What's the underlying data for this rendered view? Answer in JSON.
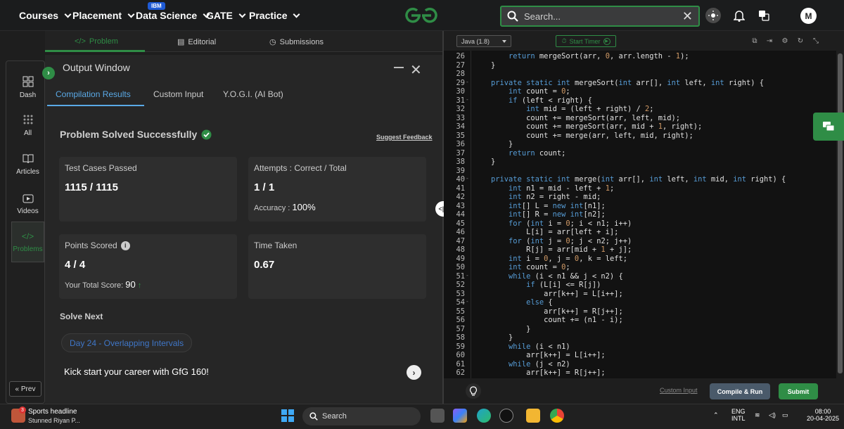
{
  "topnav": {
    "items": [
      "Courses",
      "Placement",
      "Data Science",
      "GATE",
      "Practice"
    ],
    "ibm_badge": "IBM",
    "search_placeholder": "Search...",
    "avatar_letter": "M"
  },
  "subtabs": [
    "Problem",
    "Editorial",
    "Submissions"
  ],
  "sidebar": {
    "items": [
      "Dash",
      "All",
      "Articles",
      "Videos",
      "Problems"
    ],
    "prev_label": "« Prev"
  },
  "output": {
    "title": "Output Window",
    "tabs": [
      "Compilation Results",
      "Custom Input",
      "Y.O.G.I. (AI Bot)"
    ],
    "status": "Problem Solved Successfully",
    "feedback": "Suggest Feedback",
    "cards": {
      "test_label": "Test Cases Passed",
      "test_value": "1115 / 1115",
      "attempts_label": "Attempts : Correct / Total",
      "attempts_value": "1 / 1",
      "accuracy_label": "Accuracy :",
      "accuracy_value": "100%",
      "points_label": "Points Scored",
      "points_value": "4 / 4",
      "total_score_label": "Your Total Score:",
      "total_score_value": "90",
      "time_label": "Time Taken",
      "time_value": "0.67"
    },
    "solve_next": "Solve Next",
    "next_problem": "Day 24 - Overlapping Intervals",
    "kick": "Kick start your career with GfG 160!"
  },
  "editor": {
    "language": "Java (1.8)",
    "timer_label": "Start Timer",
    "lines": [
      {
        "n": "26",
        "fold": "",
        "code": "        return mergeSort(arr, 0, arr.length - 1);"
      },
      {
        "n": "27",
        "fold": "",
        "code": "    }"
      },
      {
        "n": "28",
        "fold": "",
        "code": ""
      },
      {
        "n": "29",
        "fold": "-",
        "code": "    private static int mergeSort(int arr[], int left, int right) {"
      },
      {
        "n": "30",
        "fold": "",
        "code": "        int count = 0;"
      },
      {
        "n": "31",
        "fold": "-",
        "code": "        if (left < right) {"
      },
      {
        "n": "32",
        "fold": "",
        "code": "            int mid = (left + right) / 2;"
      },
      {
        "n": "33",
        "fold": "",
        "code": "            count += mergeSort(arr, left, mid);"
      },
      {
        "n": "34",
        "fold": "",
        "code": "            count += mergeSort(arr, mid + 1, right);"
      },
      {
        "n": "35",
        "fold": "",
        "code": "            count += merge(arr, left, mid, right);"
      },
      {
        "n": "36",
        "fold": "",
        "code": "        }"
      },
      {
        "n": "37",
        "fold": "",
        "code": "        return count;"
      },
      {
        "n": "38",
        "fold": "",
        "code": "    }"
      },
      {
        "n": "39",
        "fold": "",
        "code": ""
      },
      {
        "n": "40",
        "fold": "-",
        "code": "    private static int merge(int arr[], int left, int mid, int right) {"
      },
      {
        "n": "41",
        "fold": "",
        "code": "        int n1 = mid - left + 1;"
      },
      {
        "n": "42",
        "fold": "",
        "code": "        int n2 = right - mid;"
      },
      {
        "n": "43",
        "fold": "",
        "code": "        int[] L = new int[n1];"
      },
      {
        "n": "44",
        "fold": "",
        "code": "        int[] R = new int[n2];"
      },
      {
        "n": "45",
        "fold": "",
        "code": "        for (int i = 0; i < n1; i++)"
      },
      {
        "n": "46",
        "fold": "",
        "code": "            L[i] = arr[left + i];"
      },
      {
        "n": "47",
        "fold": "",
        "code": "        for (int j = 0; j < n2; j++)"
      },
      {
        "n": "48",
        "fold": "",
        "code": "            R[j] = arr[mid + 1 + j];"
      },
      {
        "n": "49",
        "fold": "",
        "code": "        int i = 0, j = 0, k = left;"
      },
      {
        "n": "50",
        "fold": "",
        "code": "        int count = 0;"
      },
      {
        "n": "51",
        "fold": "-",
        "code": "        while (i < n1 && j < n2) {"
      },
      {
        "n": "52",
        "fold": "",
        "code": "            if (L[i] <= R[j])"
      },
      {
        "n": "53",
        "fold": "",
        "code": "                arr[k++] = L[i++];"
      },
      {
        "n": "54",
        "fold": "-",
        "code": "            else {"
      },
      {
        "n": "55",
        "fold": "",
        "code": "                arr[k++] = R[j++];"
      },
      {
        "n": "56",
        "fold": "",
        "code": "                count += (n1 - i);"
      },
      {
        "n": "57",
        "fold": "",
        "code": "            }"
      },
      {
        "n": "58",
        "fold": "",
        "code": "        }"
      },
      {
        "n": "59",
        "fold": "",
        "code": "        while (i < n1)"
      },
      {
        "n": "60",
        "fold": "",
        "code": "            arr[k++] = L[i++];"
      },
      {
        "n": "61",
        "fold": "",
        "code": "        while (j < n2)"
      },
      {
        "n": "62",
        "fold": "",
        "code": "            arr[k++] = R[j++];"
      }
    ],
    "custom_input": "Custom Input",
    "compile_run": "Compile & Run",
    "submit": "Submit"
  },
  "taskbar": {
    "news_badge": "3",
    "news_title": "Sports headline",
    "news_sub": "Stunned Riyan P...",
    "search": "Search",
    "lang1": "ENG",
    "lang2": "INTL",
    "time": "08:00",
    "date": "20-04-2025"
  },
  "colors": {
    "accent": "#2f8d46",
    "tab_blue": "#5aa9e6",
    "bg": "#1e1e1e"
  }
}
